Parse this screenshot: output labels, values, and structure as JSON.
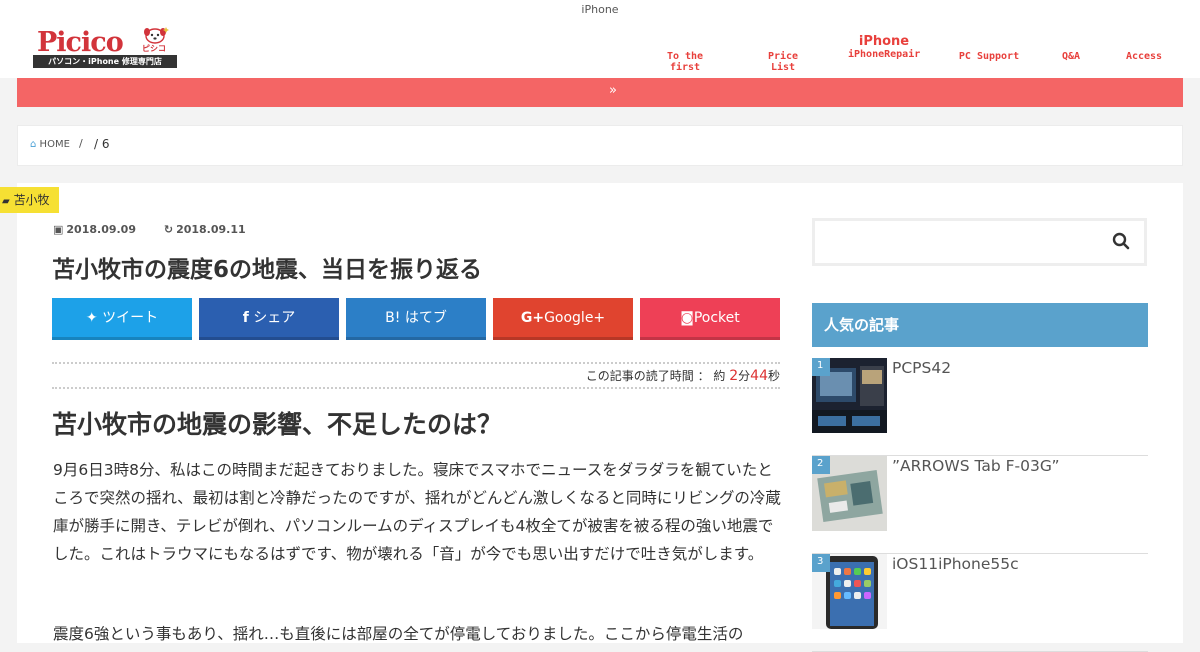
{
  "header": {
    "tagline": "iPhone",
    "logo_text": "Picico",
    "logo_kana": "ピシコ",
    "logo_sub": "パソコン・iPhone 修理専門店",
    "nav": [
      {
        "top": "",
        "label": "To the first"
      },
      {
        "top": "",
        "label": "Price List"
      },
      {
        "top": "iPhone",
        "label": "iPhoneRepair"
      },
      {
        "top": "",
        "label": "PC Support"
      },
      {
        "top": "",
        "label": "Q&A"
      },
      {
        "top": "",
        "label": "Access"
      }
    ],
    "redbar_icon": "»"
  },
  "breadcrumb": {
    "home": "HOME",
    "sep": "/",
    "current": "/ 6"
  },
  "category_tag": "苫小牧",
  "article": {
    "published": "2018.09.09",
    "updated": "2018.09.11",
    "title": "苫小牧市の震度6の地震、当日を振り返る",
    "share": [
      {
        "label": "ツイート",
        "icon": "twitter-icon",
        "color": "#1da1e8"
      },
      {
        "label": "シェア",
        "icon": "facebook-icon",
        "color": "#2b5fb0"
      },
      {
        "label": "B! はてブ",
        "icon": "hatena-icon",
        "color": "#2c7fc7"
      },
      {
        "label": "Google+",
        "icon": "google-plus-icon",
        "color": "#e0442f"
      },
      {
        "label": "Pocket",
        "icon": "pocket-icon",
        "color": "#ee4056"
      }
    ],
    "read_time_label": "この記事の読了時間 ： 約",
    "read_time_min": "2",
    "read_time_min_unit": "分",
    "read_time_sec": "44",
    "read_time_sec_unit": "秒",
    "heading": "苫小牧市の地震の影響、不足したのは？",
    "paragraph1": "9月6日3時8分、私はこの時間まだ起きておりました。寝床でスマホでニュースをダラダラを観ていたところで突然の揺れ、最初は割と冷静だったのですが、揺れがどんどん激しくなると同時にリビングの冷蔵庫が勝手に開き、テレビが倒れ、パソコンルームのディスプレイも4枚全てが被害を被る程の強い地震でした。これはトラウマにもなるはずです、物が壊れる「音」が今でも思い出すだけで吐き気がします。",
    "paragraph2": "震度6強という事もあり、揺れ…も直後には部屋の全てが停電しておりました。ここから停電生活の"
  },
  "sidebar": {
    "search_placeholder": "",
    "popular_heading": "人気の記事",
    "popular": [
      {
        "rank": "1",
        "title": "PCPS42"
      },
      {
        "rank": "2",
        "title": "”ARROWS Tab F-03G”"
      },
      {
        "rank": "3",
        "title": "iOS11iPhone55c"
      }
    ]
  },
  "colors": {
    "accent_red": "#f46565",
    "nav_red": "#e8403c",
    "sidebar_blue": "#5aa2cc",
    "tag_yellow": "#f6e033",
    "read_red": "#d33"
  }
}
